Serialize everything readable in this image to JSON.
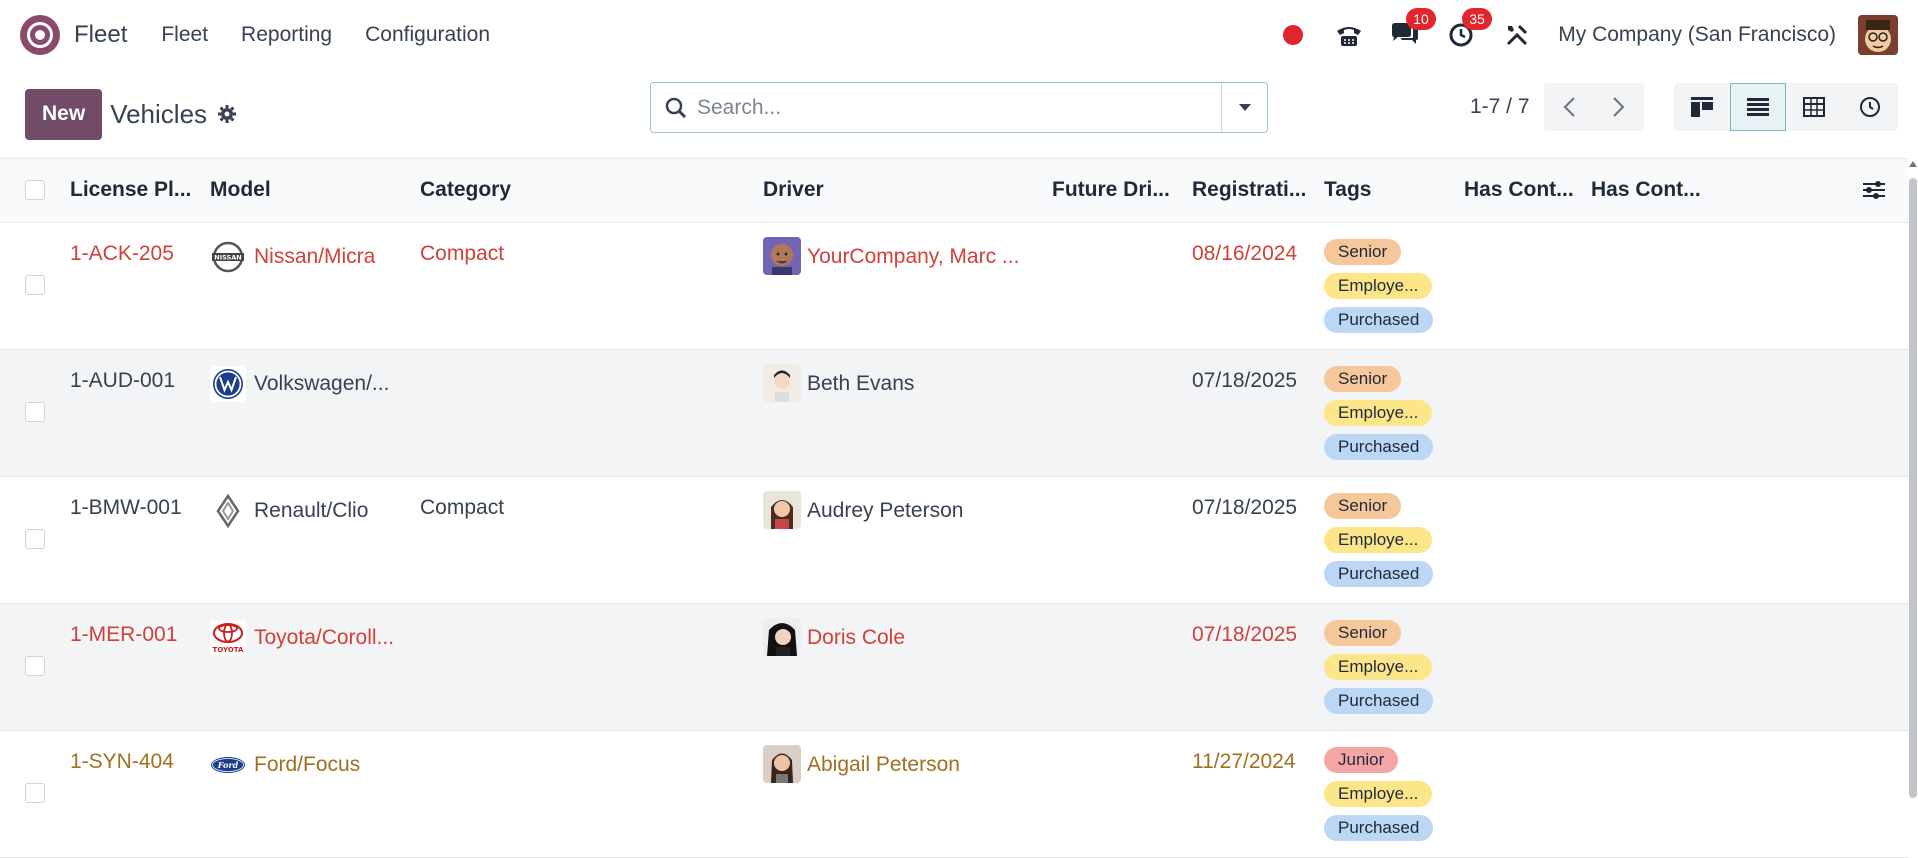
{
  "nav": {
    "app_name": "Fleet",
    "menu": [
      "Fleet",
      "Reporting",
      "Configuration"
    ],
    "messages_badge": "10",
    "activities_badge": "35",
    "company": "My Company (San Francisco)"
  },
  "control": {
    "new_label": "New",
    "title": "Vehicles",
    "search_placeholder": "Search...",
    "pager": "1-7 / 7"
  },
  "table": {
    "headers": [
      "License Pl...",
      "Model",
      "Category",
      "Driver",
      "Future Dri...",
      "Registrati...",
      "Tags",
      "Has Cont...",
      "Has Cont..."
    ],
    "rows": [
      {
        "plate": "1-ACK-205",
        "model": "Nissan/Micra",
        "brand_icon": "nissan-logo-icon",
        "category": "Compact",
        "driver": "YourCompany, Marc ...",
        "date": "08/16/2024",
        "tags": [
          "Senior",
          "Employe...",
          "Purchased"
        ],
        "color": "#d1413a"
      },
      {
        "plate": "1-AUD-001",
        "model": "Volkswagen/...",
        "brand_icon": "volkswagen-logo-icon",
        "category": "",
        "driver": "Beth Evans",
        "date": "07/18/2025",
        "tags": [
          "Senior",
          "Employe...",
          "Purchased"
        ],
        "color": "#374151"
      },
      {
        "plate": "1-BMW-001",
        "model": "Renault/Clio",
        "brand_icon": "renault-logo-icon",
        "category": "Compact",
        "driver": "Audrey Peterson",
        "date": "07/18/2025",
        "tags": [
          "Senior",
          "Employe...",
          "Purchased"
        ],
        "color": "#374151"
      },
      {
        "plate": "1-MER-001",
        "model": "Toyota/Coroll...",
        "brand_icon": "toyota-logo-icon",
        "category": "",
        "driver": "Doris Cole",
        "date": "07/18/2025",
        "tags": [
          "Senior",
          "Employe...",
          "Purchased"
        ],
        "color": "#d1413a"
      },
      {
        "plate": "1-SYN-404",
        "model": "Ford/Focus",
        "brand_icon": "ford-logo-icon",
        "category": "",
        "driver": "Abigail Peterson",
        "date": "11/27/2024",
        "tags": [
          "Junior",
          "Employe...",
          "Purchased"
        ],
        "color": "#a0701f"
      }
    ]
  }
}
